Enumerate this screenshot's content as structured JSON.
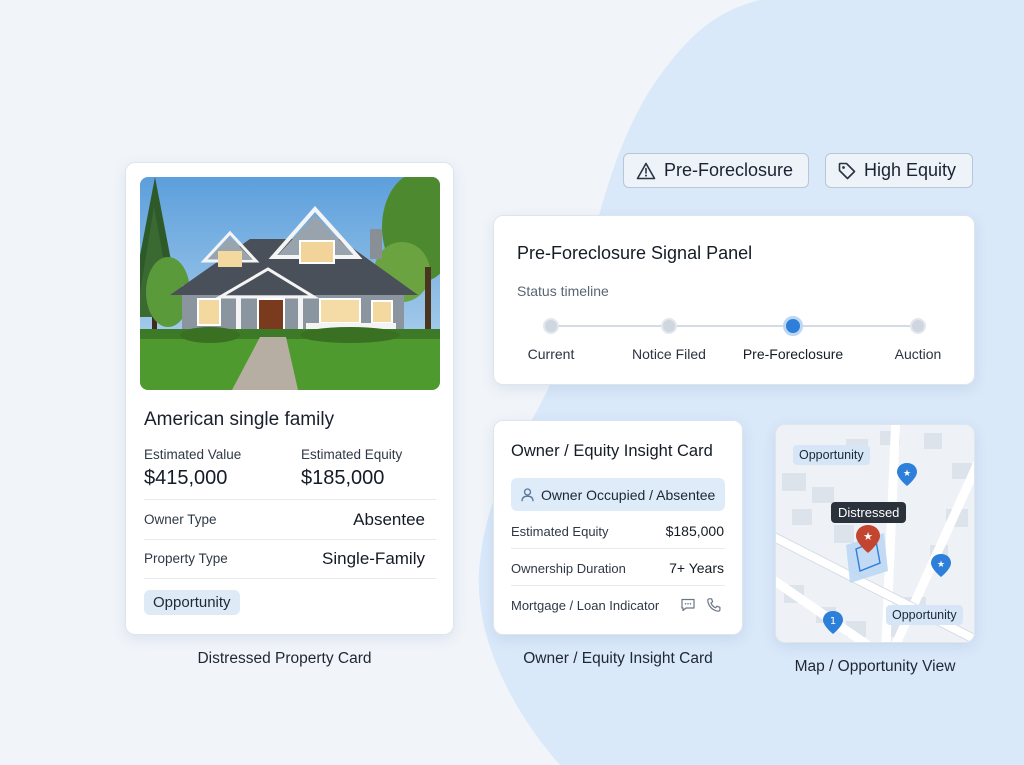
{
  "colors": {
    "background": "#f1f5fa",
    "blob": "#d9e9fa",
    "accent_blue": "#2d7fd9",
    "chip_blue": "#dfeaf7",
    "pin_red": "#c4452f",
    "pin_blue": "#2d7fd9"
  },
  "badges": {
    "pre_foreclosure": {
      "label": "Pre-Foreclosure",
      "icon": "warning-triangle-icon"
    },
    "high_equity": {
      "label": "High Equity",
      "icon": "tag-icon"
    }
  },
  "property_card": {
    "title": "American single family",
    "estimated_value_label": "Estimated Value",
    "estimated_value": "$415,000",
    "estimated_equity_label": "Estimated Equity",
    "estimated_equity": "$185,000",
    "owner_type_label": "Owner Type",
    "owner_type": "Absentee",
    "property_type_label": "Property Type",
    "property_type": "Single-Family",
    "chip": "Opportunity",
    "caption": "Distressed Property Card"
  },
  "signal_panel": {
    "title": "Pre-Foreclosure Signal Panel",
    "subtitle": "Status timeline",
    "steps": [
      {
        "label": "Current",
        "active": false
      },
      {
        "label": "Notice Filed",
        "active": false
      },
      {
        "label": "Pre-Foreclosure",
        "active": true
      },
      {
        "label": "Auction",
        "active": false
      }
    ]
  },
  "owner_card": {
    "title": "Owner / Equity Insight Card",
    "chip": "Owner Occupied / Absentee",
    "chip_icon": "person-icon",
    "rows": [
      {
        "label": "Estimated Equity",
        "value": "$185,000"
      },
      {
        "label": "Ownership Duration",
        "value": "7+ Years"
      },
      {
        "label": "Mortgage / Loan Indicator",
        "icons": [
          "message-icon",
          "phone-icon"
        ]
      }
    ],
    "caption": "Owner / Equity Insight Card"
  },
  "map_card": {
    "chip_top": "Opportunity",
    "tooltip": "Distressed",
    "chip_bottom": "Opportunity",
    "numbered_pin": "1",
    "caption": "Map / Opportunity View"
  }
}
